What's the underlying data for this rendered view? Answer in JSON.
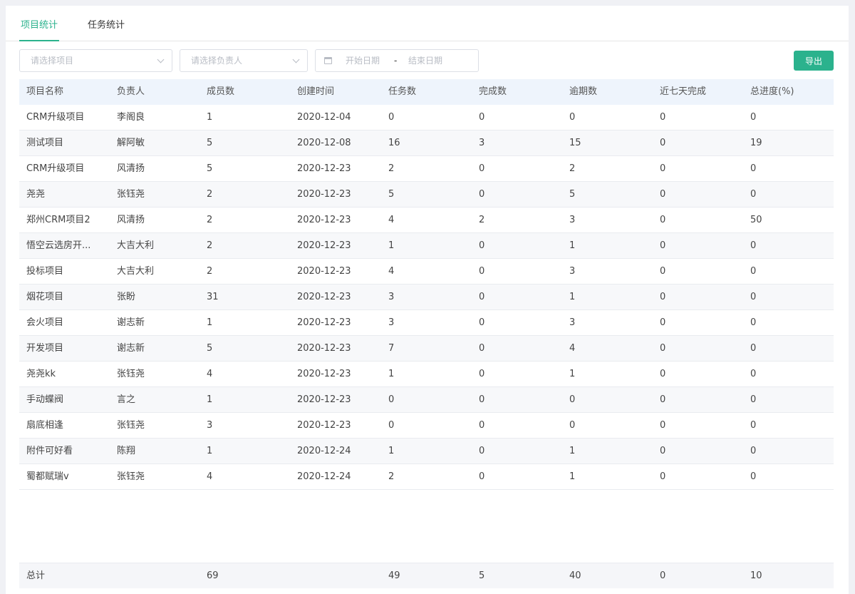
{
  "tabs": [
    {
      "label": "项目统计",
      "active": true
    },
    {
      "label": "任务统计",
      "active": false
    }
  ],
  "filters": {
    "project_placeholder": "请选择项目",
    "owner_placeholder": "请选择负责人",
    "start_date_placeholder": "开始日期",
    "date_separator": "-",
    "end_date_placeholder": "结束日期"
  },
  "export_label": "导出",
  "colors": {
    "accent": "#2bb28d",
    "header_bg": "#eef4fc"
  },
  "table": {
    "headers": [
      "项目名称",
      "负责人",
      "成员数",
      "创建时间",
      "任务数",
      "完成数",
      "逾期数",
      "近七天完成",
      "总进度(%)"
    ],
    "rows": [
      [
        "CRM升级项目",
        "李阁良",
        "1",
        "2020-12-04",
        "0",
        "0",
        "0",
        "0",
        "0"
      ],
      [
        "测试项目",
        "解阿敏",
        "5",
        "2020-12-08",
        "16",
        "3",
        "15",
        "0",
        "19"
      ],
      [
        "CRM升级项目",
        "风清扬",
        "5",
        "2020-12-23",
        "2",
        "0",
        "2",
        "0",
        "0"
      ],
      [
        "尧尧",
        "张钰尧",
        "2",
        "2020-12-23",
        "5",
        "0",
        "5",
        "0",
        "0"
      ],
      [
        "郑州CRM项目2",
        "风清扬",
        "2",
        "2020-12-23",
        "4",
        "2",
        "3",
        "0",
        "50"
      ],
      [
        "悟空云选房开...",
        "大吉大利",
        "2",
        "2020-12-23",
        "1",
        "0",
        "1",
        "0",
        "0"
      ],
      [
        "投标项目",
        "大吉大利",
        "2",
        "2020-12-23",
        "4",
        "0",
        "3",
        "0",
        "0"
      ],
      [
        "烟花项目",
        "张盼",
        "31",
        "2020-12-23",
        "3",
        "0",
        "1",
        "0",
        "0"
      ],
      [
        "会火项目",
        "谢志新",
        "1",
        "2020-12-23",
        "3",
        "0",
        "3",
        "0",
        "0"
      ],
      [
        "开发项目",
        "谢志新",
        "5",
        "2020-12-23",
        "7",
        "0",
        "4",
        "0",
        "0"
      ],
      [
        "尧尧kk",
        "张钰尧",
        "4",
        "2020-12-23",
        "1",
        "0",
        "1",
        "0",
        "0"
      ],
      [
        "手动蝶阀",
        "言之",
        "1",
        "2020-12-23",
        "0",
        "0",
        "0",
        "0",
        "0"
      ],
      [
        "扇底相逢",
        "张钰尧",
        "3",
        "2020-12-23",
        "0",
        "0",
        "0",
        "0",
        "0"
      ],
      [
        "附件可好看",
        "陈翔",
        "1",
        "2020-12-24",
        "1",
        "0",
        "1",
        "0",
        "0"
      ],
      [
        "蜀都赋瑞v",
        "张钰尧",
        "4",
        "2020-12-24",
        "2",
        "0",
        "1",
        "0",
        "0"
      ]
    ],
    "total_row": [
      "总计",
      "",
      "69",
      "",
      "49",
      "5",
      "40",
      "0",
      "10"
    ]
  }
}
